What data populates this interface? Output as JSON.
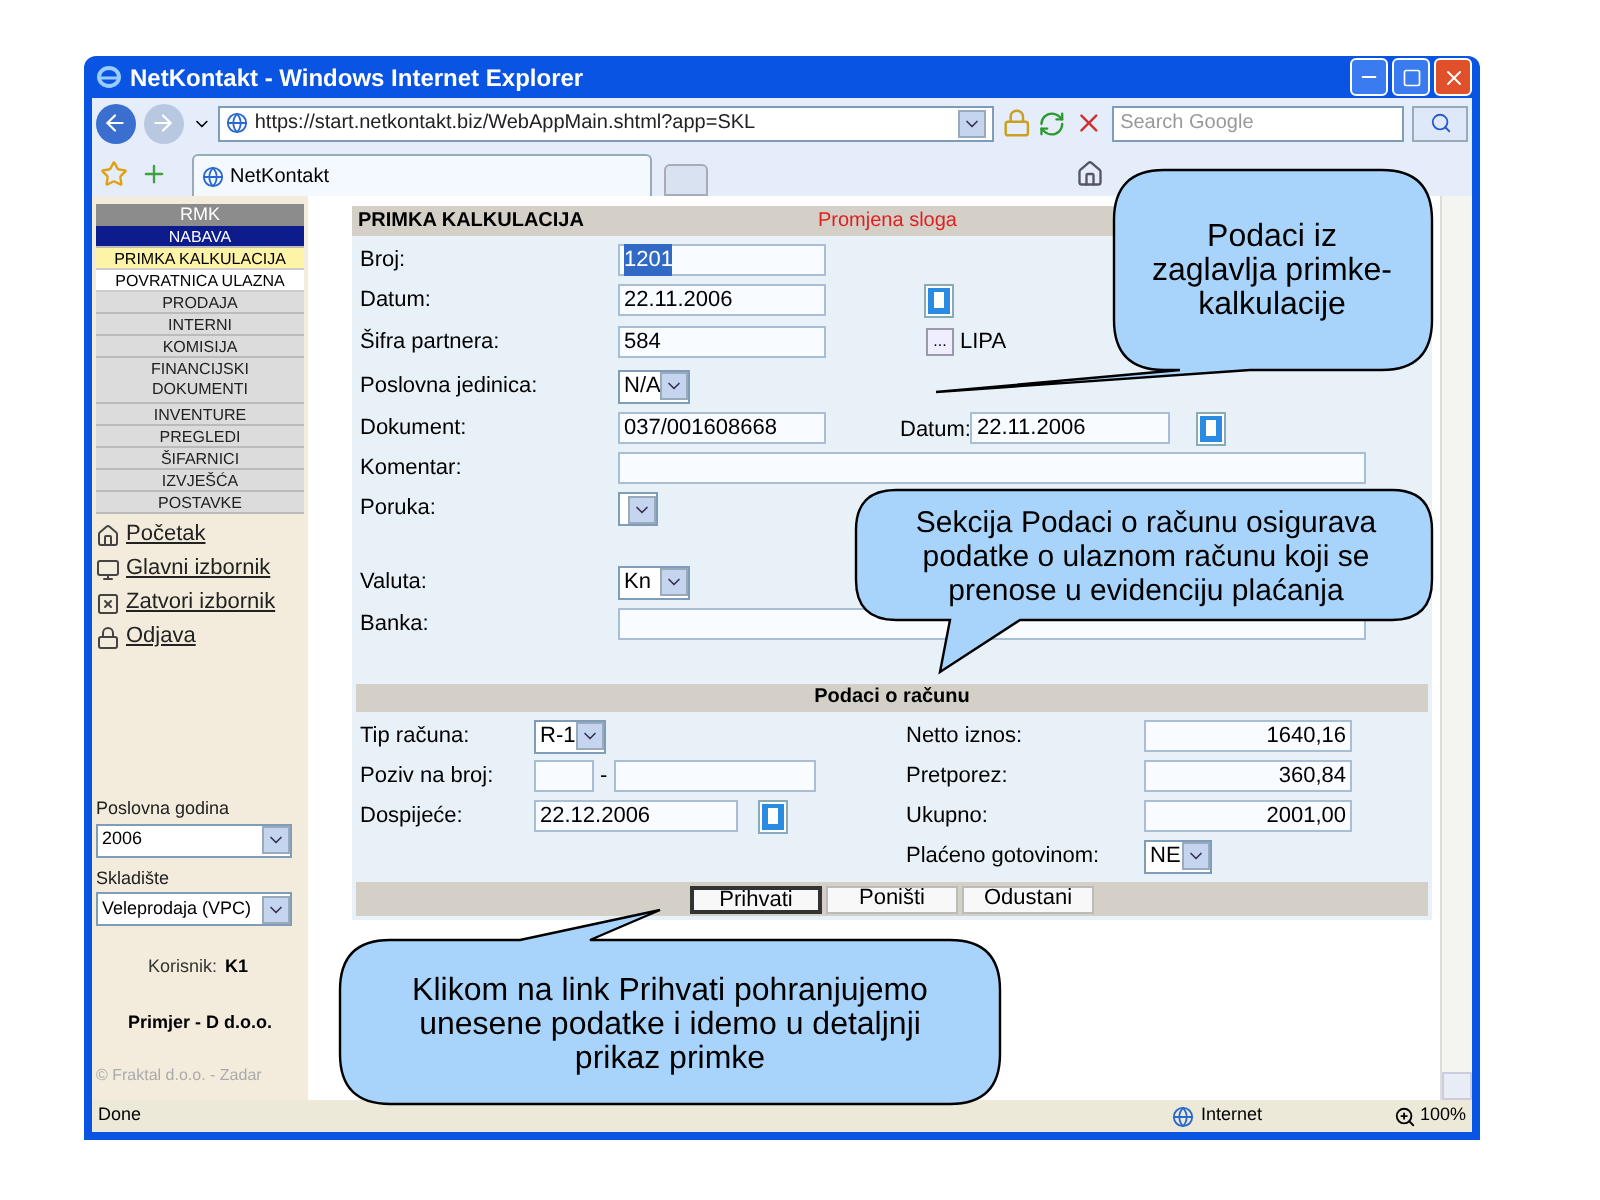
{
  "window": {
    "title": "NetKontakt - Windows Internet Explorer"
  },
  "address_bar": {
    "url": "https://start.netkontakt.biz/WebAppMain.shtml?app=SKL"
  },
  "search": {
    "placeholder": "Search Google"
  },
  "tabs": [
    {
      "label": "NetKontakt",
      "selected": true
    }
  ],
  "sidebar": {
    "header": "RMK",
    "items": [
      {
        "label": "NABAVA",
        "kind": "group",
        "expanded": true
      },
      {
        "label": "PRIMKA KALKULACIJA",
        "kind": "subitem",
        "selected": true
      },
      {
        "label": "POVRATNICA ULAZNA",
        "kind": "subitem",
        "selected": false
      },
      {
        "label": "PRODAJA",
        "kind": "group",
        "expanded": false
      },
      {
        "label": "INTERNI",
        "kind": "group",
        "expanded": false
      },
      {
        "label": "KOMISIJA",
        "kind": "group",
        "expanded": false
      },
      {
        "label": "FINANCIJSKI DOKUMENTI",
        "kind": "group",
        "expanded": false
      },
      {
        "label": "INVENTURE",
        "kind": "group",
        "expanded": false
      },
      {
        "label": "PREGLEDI",
        "kind": "group",
        "expanded": false
      },
      {
        "label": "ŠIFARNICI",
        "kind": "group",
        "expanded": false
      },
      {
        "label": "IZVJEŠĆA",
        "kind": "group",
        "expanded": false
      },
      {
        "label": "POSTAVKE",
        "kind": "group",
        "expanded": false
      }
    ],
    "links": [
      {
        "label": "Početak",
        "kind": "home"
      },
      {
        "label": "Glavni izbornik",
        "kind": "menu"
      },
      {
        "label": "Zatvori izbornik",
        "kind": "close"
      },
      {
        "label": "Odjava",
        "kind": "logout"
      }
    ],
    "year": {
      "label": "Poslovna godina",
      "value": "2006"
    },
    "warehouse": {
      "label": "Skladište",
      "value": "Veleprodaja (VPC)"
    },
    "user": {
      "label": "Korisnik:",
      "value": "K1"
    },
    "company": "Primjer - D d.o.o.",
    "copyright": "© Fraktal d.o.o. - Zadar"
  },
  "form": {
    "title": "PRIMKA KALKULACIJA",
    "status": "Promjena sloga",
    "fields": [
      {
        "kind": "text",
        "label": "Broj:",
        "value": "1201",
        "highlighted": true
      },
      {
        "kind": "date",
        "label": "Datum:",
        "value": "22.11.2006",
        "highlighted": false
      },
      {
        "kind": "lookup",
        "label": "Šifra partnera:",
        "value": "584",
        "button": "...",
        "name": "LIPA"
      },
      {
        "kind": "select",
        "label": "Poslovna jedinica:",
        "value": "N/A"
      },
      {
        "kind": "text-date",
        "label": "Dokument:",
        "value": "037/001608668",
        "date_label": "Datum:",
        "date_value": "22.11.2006"
      },
      {
        "kind": "wide",
        "label": "Komentar:"
      },
      {
        "kind": "message",
        "label": "Poruka:"
      },
      {
        "kind": "select",
        "label": "Valuta:",
        "value": "Kn"
      },
      {
        "kind": "wide",
        "label": "Banka:"
      }
    ],
    "invoice": {
      "title": "Podaci o računu",
      "left": [
        {
          "kind": "select",
          "label": "Tip računa:",
          "value": "R-1"
        },
        {
          "kind": "split",
          "label": "Poziv na broj:",
          "separator": "-"
        },
        {
          "kind": "date",
          "label": "Dospijeće:",
          "value": "22.12.2006"
        }
      ],
      "right": [
        {
          "kind": "amount",
          "label": "Netto iznos:",
          "value": "1640,16"
        },
        {
          "kind": "amount",
          "label": "Pretporez:",
          "value": "360,84"
        },
        {
          "kind": "amount",
          "label": "Ukupno:",
          "value": "2001,00"
        },
        {
          "kind": "select",
          "label": "Plaćeno gotovinom:",
          "value": "NE"
        }
      ]
    },
    "buttons": [
      {
        "label": "Prihvati",
        "selected": true
      },
      {
        "label": "Poništi",
        "selected": false
      },
      {
        "label": "Odustani",
        "selected": false
      }
    ]
  },
  "callouts": [
    {
      "text": "Podaci iz zaglavlja primke-kalkulacije"
    },
    {
      "text": "Sekcija Podaci o računu osigurava podatke o ulaznom računu koji se prenose u evidenciju plaćanja"
    },
    {
      "text": "Klikom na link Prihvati pohranjujemo unesene podatke i idemo u detaljnji prikaz primke"
    }
  ],
  "status_bar": {
    "text": "Done",
    "zone": "Internet",
    "zoom": "100%"
  }
}
